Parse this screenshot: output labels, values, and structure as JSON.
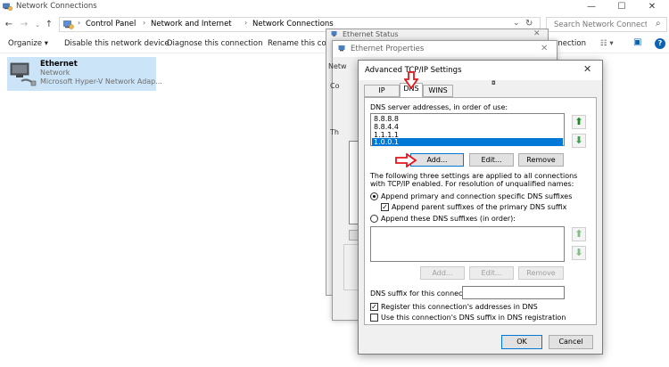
{
  "window": {
    "title": "Network Connections",
    "controls": {
      "minimize": "—",
      "maximize": "☐",
      "close": "✕"
    }
  },
  "address": {
    "back": "←",
    "forward": "→",
    "up": "↑",
    "crumbs": [
      "Control Panel",
      "Network and Internet",
      "Network Connections"
    ],
    "separator": "›",
    "dropdown": "⌄",
    "refresh": "↻",
    "search_placeholder": "Search Network Connections",
    "search_icon": "⌕"
  },
  "toolbar": {
    "organize": "Organize ▾",
    "disable": "Disable this network device",
    "diagnose": "Diagnose this connection",
    "rename": "Rename this conne",
    "right_label": "nnection",
    "view_icon": "☷ ▾",
    "pane_icon": "▣",
    "help_icon": "?"
  },
  "connection": {
    "name": "Ethernet",
    "status": "Network",
    "device": "Microsoft Hyper-V Network Adap..."
  },
  "status_dialog": {
    "title": "Ethernet Status",
    "close": "✕",
    "side_labels": [
      "Netw",
      "Co",
      "Th"
    ]
  },
  "props_dialog": {
    "title": "Ethernet Properties",
    "close": "✕"
  },
  "advanced": {
    "title": "Advanced TCP/IP Settings",
    "close": "✕",
    "tabs": [
      "IP Settings",
      "DNS",
      "WINS"
    ],
    "dns_list_label": "DNS server addresses, in order of use:",
    "dns_servers": [
      "8.8.8.8",
      "8.8.4.4",
      "1.1.1.1",
      "1.0.0.1"
    ],
    "selected_index": 3,
    "buttons": {
      "add": "Add...",
      "edit": "Edit...",
      "remove": "Remove"
    },
    "info_text": "The following three settings are applied to all connections with TCP/IP enabled. For resolution of unqualified names:",
    "radio_primary": "Append primary and connection specific DNS suffixes",
    "check_parent": "Append parent suffixes of the primary DNS suffix",
    "radio_these": "Append these DNS suffixes (in order):",
    "suffix_buttons": {
      "add": "Add...",
      "edit": "Edit...",
      "remove": "Remove"
    },
    "suffix_label": "DNS suffix for this connection:",
    "suffix_value": "",
    "check_register": "Register this connection's addresses in DNS",
    "check_use_suffix": "Use this connection's DNS suffix in DNS registration",
    "ok": "OK",
    "cancel": "Cancel",
    "up_arrow": "⬆",
    "down_arrow": "⬇"
  },
  "colors": {
    "selection": "#0078d7",
    "annotation": "#e4151b",
    "file_highlight": "#cce4f7"
  }
}
